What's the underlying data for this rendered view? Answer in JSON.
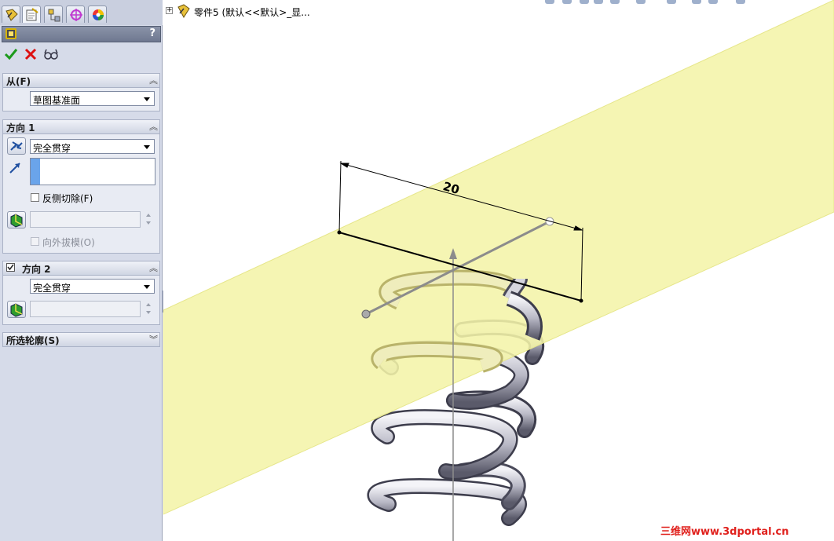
{
  "property_manager": {
    "tabs": [
      {
        "icon": "feature-manager-icon",
        "active": false
      },
      {
        "icon": "property-manager-icon",
        "active": true
      },
      {
        "icon": "configuration-manager-icon",
        "active": false
      },
      {
        "icon": "dimxpert-icon",
        "active": false
      },
      {
        "icon": "display-manager-icon",
        "active": false
      }
    ],
    "help_label": "?",
    "actions": {
      "ok_icon": "checkmark-icon",
      "cancel_icon": "x-icon",
      "preview_icon": "glasses-icon"
    },
    "from_group": {
      "title": "从(F)",
      "selected": "草图基准面"
    },
    "direction1": {
      "title": "方向 1",
      "end_condition": "完全贯穿",
      "flip_side_label": "反侧切除(F)",
      "draft_outward_label": "向外拔模(O)"
    },
    "direction2": {
      "title": "方向 2",
      "checked": true,
      "end_condition": "完全贯穿"
    },
    "selected_contours": {
      "title": "所选轮廓(S)"
    }
  },
  "viewport": {
    "tree_root": "零件5  (默认<<默认>_显...",
    "dimension_value": "20",
    "plane_color": "#f4f4a8",
    "watermark": "三维网www.3dportal.cn"
  }
}
